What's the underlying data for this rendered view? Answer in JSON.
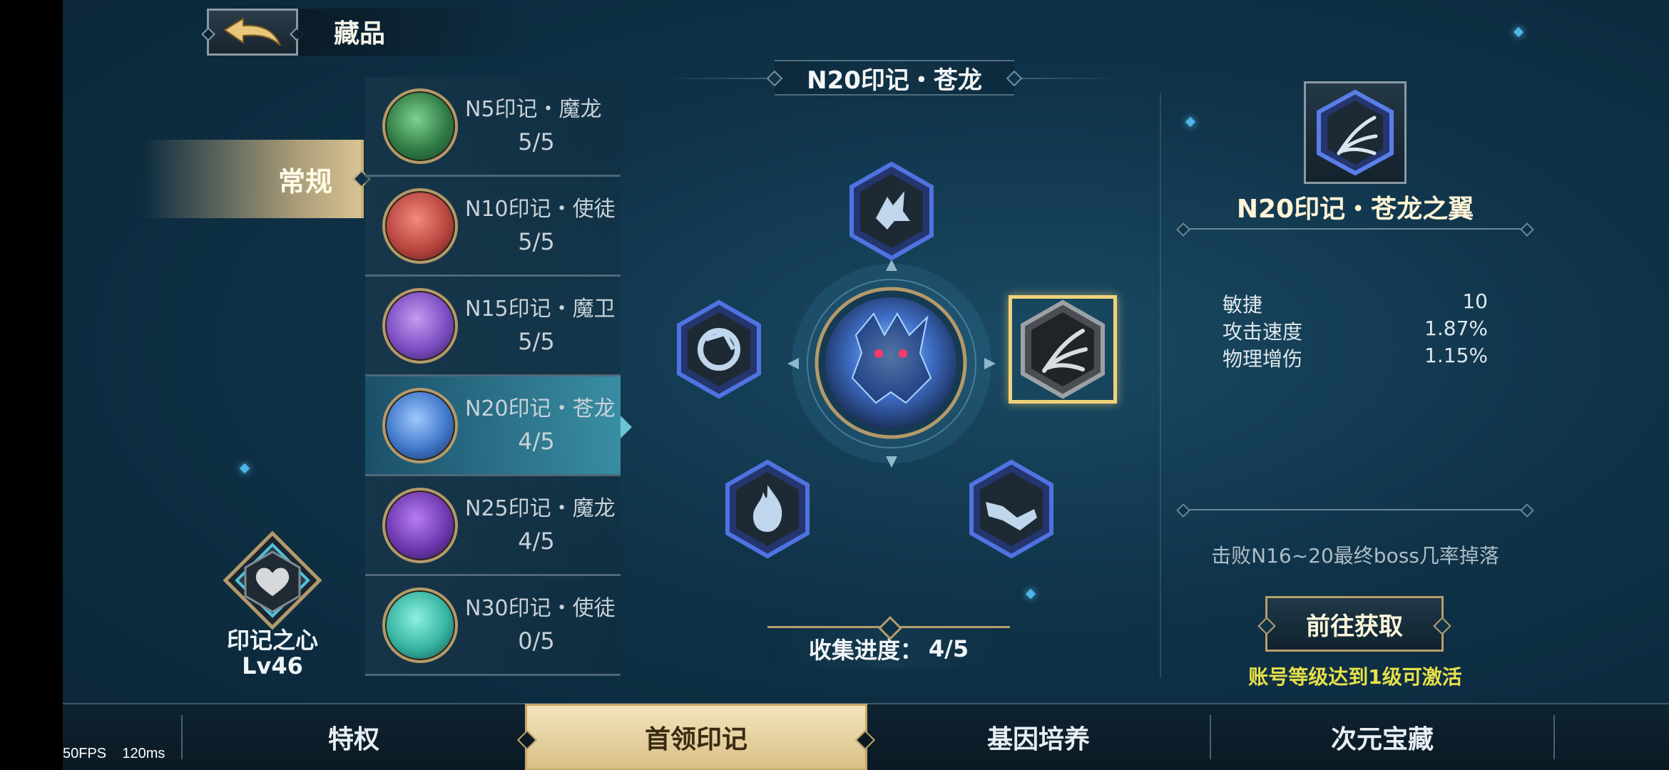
{
  "header": {
    "title": "藏品"
  },
  "category_tab": {
    "label": "常规"
  },
  "marks": [
    {
      "name": "N5印记・魔龙",
      "progress": "5/5",
      "color": "#3d8f53"
    },
    {
      "name": "N10印记・使徒",
      "progress": "5/5",
      "color": "#b8453f"
    },
    {
      "name": "N15印记・魔卫",
      "progress": "5/5",
      "color": "#7a4cc2"
    },
    {
      "name": "N20印记・苍龙",
      "progress": "4/5",
      "color": "#3f76c8"
    },
    {
      "name": "N25印记・魔龙",
      "progress": "4/5",
      "color": "#6d37b0"
    },
    {
      "name": "N30印记・使徒",
      "progress": "0/5",
      "color": "#34b3a0"
    }
  ],
  "heart": {
    "name": "印记之心",
    "level": "Lv46"
  },
  "center": {
    "title": "N20印记・苍龙",
    "progress_label": "收集进度：",
    "progress_value": "4/5"
  },
  "detail": {
    "name": "N20印记・苍龙之翼",
    "stats": [
      {
        "label": "敏捷",
        "value": "10"
      },
      {
        "label": "攻击速度",
        "value": "1.87%"
      },
      {
        "label": "物理增伤",
        "value": "1.15%"
      }
    ],
    "drop_note": "击败N16~20最终boss几率掉落",
    "go_button": "前往获取",
    "activate_note": "账号等级达到1级可激活"
  },
  "nav": {
    "tabs": [
      "特权",
      "首领印记",
      "基因培养",
      "次元宝藏"
    ],
    "active_index": 1
  },
  "overlay": {
    "fps": "50FPS",
    "latency": "120ms"
  }
}
